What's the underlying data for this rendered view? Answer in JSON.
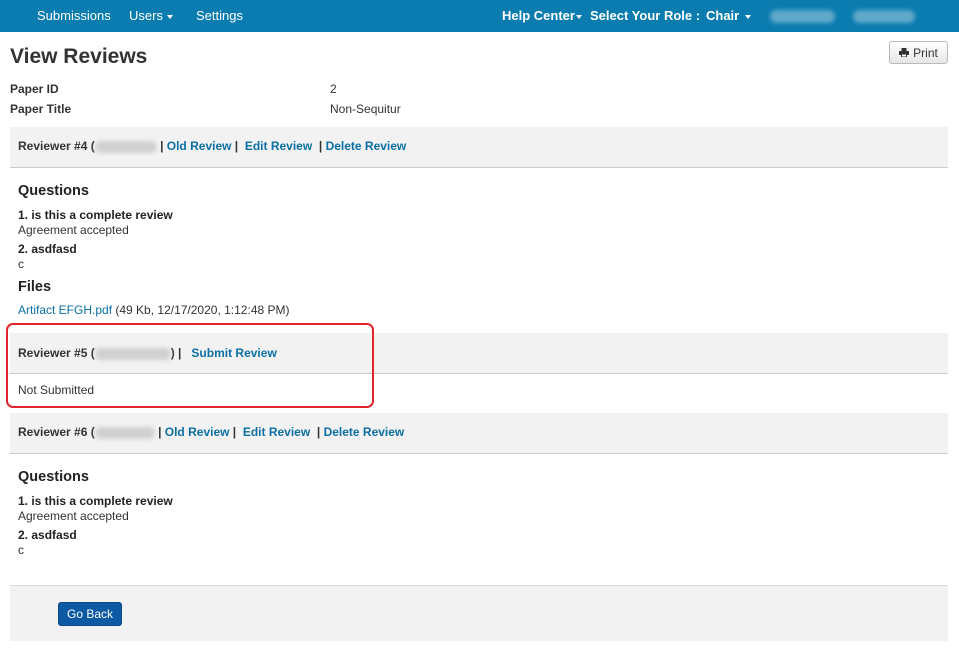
{
  "nav": {
    "submissions": "Submissions",
    "users": "Users",
    "settings": "Settings",
    "help_center": "Help Center",
    "select_role_label": "Select Your Role :",
    "role": "Chair"
  },
  "page": {
    "title": "View Reviews",
    "print_label": "Print"
  },
  "paper": {
    "id_label": "Paper ID",
    "id_value": "2",
    "title_label": "Paper Title",
    "title_value": "Non-Sequitur"
  },
  "reviews": [
    {
      "name": "Reviewer #4 (",
      "sep1": "|",
      "old_review": "Old Review",
      "sep2": "|",
      "edit_review": "Edit Review",
      "sep3": "|",
      "delete_review": "Delete Review",
      "questions_heading": "Questions",
      "questions": [
        {
          "q": "1. is this a complete review",
          "a": "Agreement accepted"
        },
        {
          "q": "2. asdfasd",
          "a": "c"
        }
      ],
      "files_heading": "Files",
      "file": {
        "name": "Artifact EFGH.pdf",
        "meta": "(49 Kb, 12/17/2020, 1:12:48 PM)"
      }
    },
    {
      "name": "Reviewer #5 (",
      "close": ") |",
      "submit_review": "Submit Review",
      "status": "Not Submitted"
    },
    {
      "name": "Reviewer #6 (",
      "sep1": "|",
      "old_review": "Old Review",
      "sep2": "|",
      "edit_review": "Edit Review",
      "sep3": "|",
      "delete_review": "Delete Review",
      "questions_heading": "Questions",
      "questions": [
        {
          "q": "1. is this a complete review",
          "a": "Agreement accepted"
        },
        {
          "q": "2. asdfasd",
          "a": "c"
        }
      ]
    }
  ],
  "footer": {
    "go_back": "Go Back"
  },
  "colors": {
    "navbar": "#0b7cb0",
    "link": "#0b6fa4",
    "highlight": "#e0262a",
    "button": "#0b5aa3"
  }
}
